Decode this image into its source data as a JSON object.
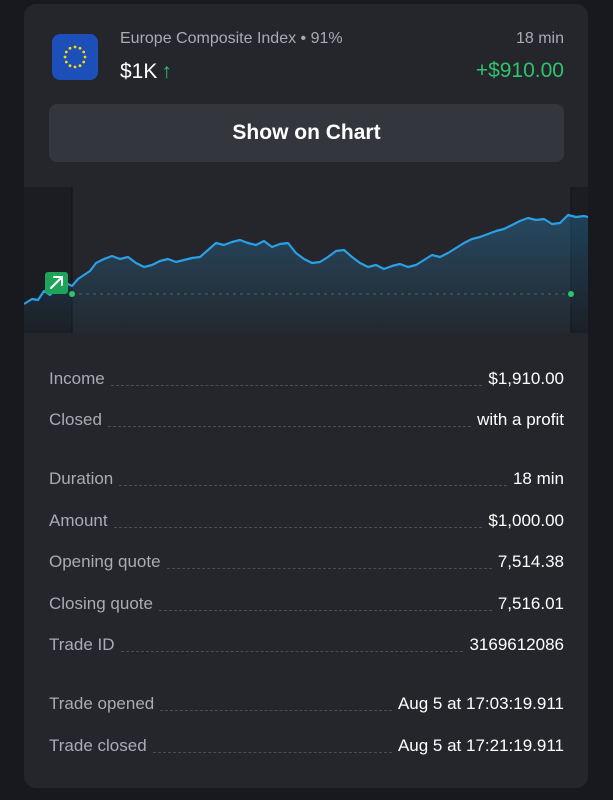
{
  "header": {
    "asset_name": "Europe Composite Index • 91%",
    "duration": "18 min",
    "amount": "$1K",
    "amount_arrow": "↑",
    "profit": "+$910.00",
    "flag_icon": "eu-flag-icon"
  },
  "button": {
    "label": "Show on Chart"
  },
  "chart": {
    "direction_icon": "arrow-up-right-icon",
    "line_color": "#2a9fe6",
    "accent_color": "#2fc36d"
  },
  "details": {
    "rows": [
      {
        "label": "Income",
        "value": "$1,910.00"
      },
      {
        "label": "Closed",
        "value": "with a profit"
      },
      {
        "label": "Duration",
        "value": "18 min"
      },
      {
        "label": "Amount",
        "value": "$1,000.00"
      },
      {
        "label": "Opening quote",
        "value": "7,514.38"
      },
      {
        "label": "Closing quote",
        "value": "7,516.01"
      },
      {
        "label": "Trade ID",
        "value": "3169612086"
      },
      {
        "label": "Trade opened",
        "value": "Aug 5 at 17:03:19.911"
      },
      {
        "label": "Trade closed",
        "value": "Aug 5 at 17:21:19.911"
      }
    ]
  }
}
